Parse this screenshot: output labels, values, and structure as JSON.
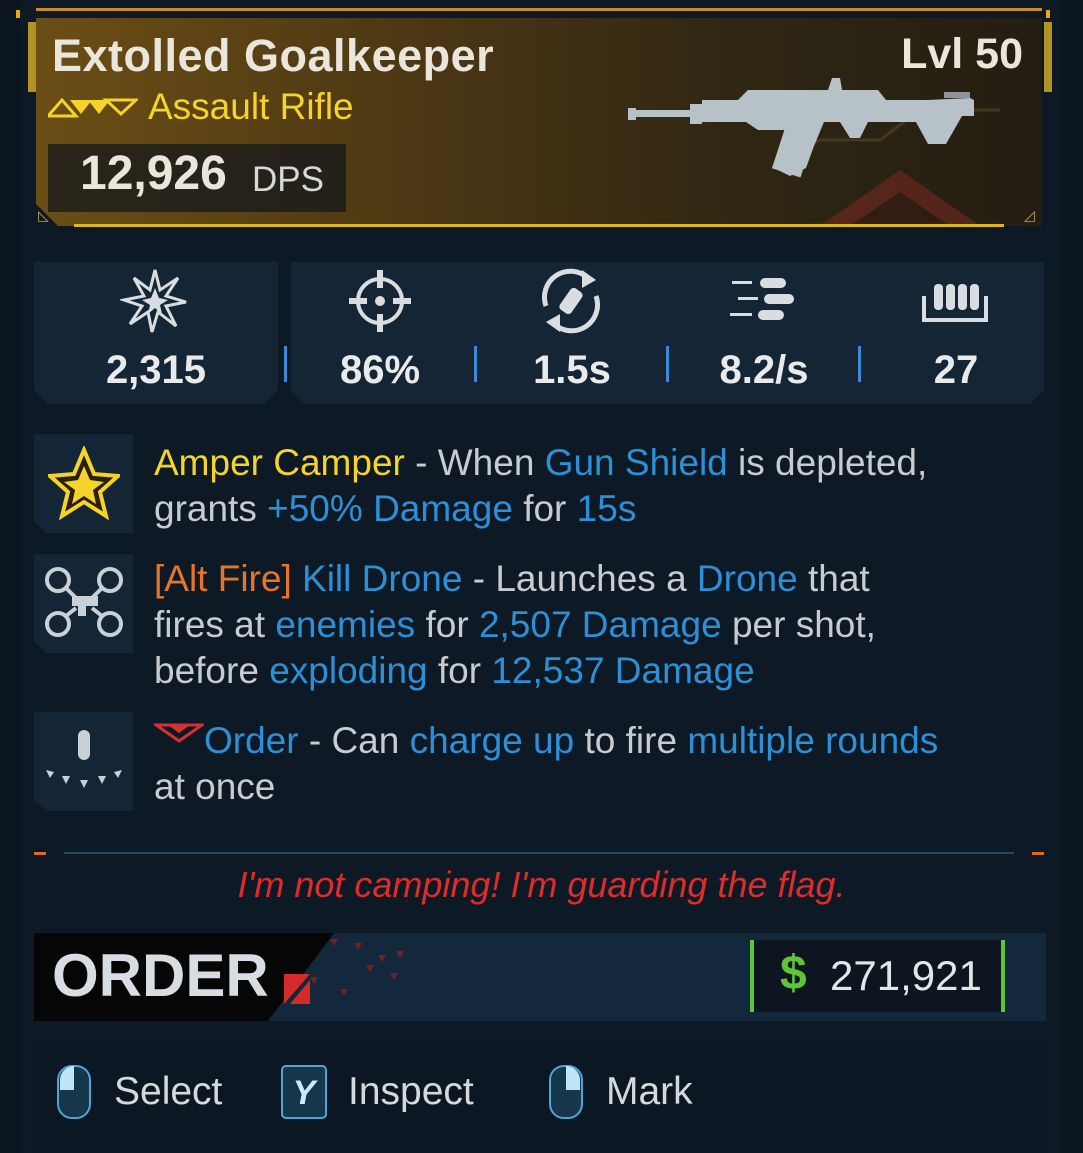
{
  "weapon": {
    "name": "Extolled Goalkeeper",
    "level": "Lvl 50",
    "type": "Assault Rifle",
    "dps_value": "12,926",
    "dps_label": "DPS",
    "rarity_color": "#f6d32b"
  },
  "stats": [
    {
      "icon": "burst-damage-icon",
      "value": "2,315"
    },
    {
      "icon": "crosshair-accuracy-icon",
      "value": "86%"
    },
    {
      "icon": "reload-icon",
      "value": "1.5s"
    },
    {
      "icon": "fire-rate-icon",
      "value": "8.2/s"
    },
    {
      "icon": "magazine-icon",
      "value": "27"
    }
  ],
  "perks": [
    {
      "icon": "star-badge-icon",
      "line1": {
        "name": "Amper Camper",
        "t1": " - When ",
        "k1": "Gun Shield",
        "t2": " is depleted,"
      },
      "line2": {
        "t1": "grants ",
        "k1": "+50% Damage",
        "t2": " for ",
        "k2": "15s"
      }
    },
    {
      "icon": "drone-icon",
      "line1": {
        "tag": "[Alt Fire]",
        "name": " Kill Drone",
        "t1": " - Launches a ",
        "k1": "Drone",
        "t2": " that"
      },
      "line2": {
        "t1": "fires at ",
        "k1": "enemies",
        "t2": " for ",
        "k2": "2,507 Damage",
        "t3": " per shot,"
      },
      "line3": {
        "t1": "before ",
        "k1": "exploding",
        "t2": " for ",
        "k2": "12,537 Damage"
      }
    },
    {
      "icon": "bullet-burst-icon",
      "line1": {
        "name": "Order",
        "t1": " - Can ",
        "k1": "charge up",
        "t2": " to fire ",
        "k2": "multiple rounds"
      },
      "line2": {
        "t1": "at once"
      }
    }
  ],
  "flavor_text": "I'm not camping! I'm guarding the flag.",
  "manufacturer": {
    "name": "ORDER"
  },
  "price": {
    "currency_icon": "$",
    "value": "271,921",
    "color": "#5ec43a"
  },
  "actions": [
    {
      "icon": "mouse-left-icon",
      "label": "Select"
    },
    {
      "icon": "y-key-icon",
      "key": "Y",
      "label": "Inspect"
    },
    {
      "icon": "mouse-right-icon",
      "label": "Mark"
    }
  ]
}
